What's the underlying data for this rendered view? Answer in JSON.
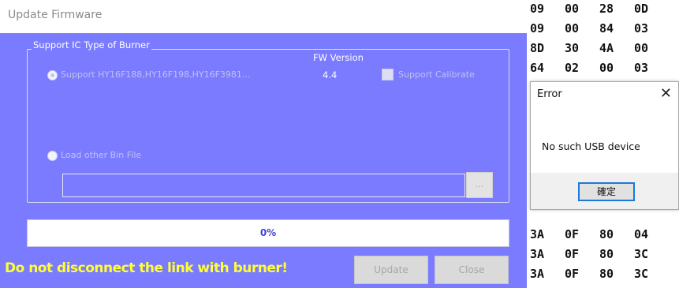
{
  "dialog": {
    "title": "Update Firmware",
    "group_title": "Support IC Type of Burner",
    "fw_version_label": "FW Version",
    "fw_version_value": "4.4",
    "option_support_label": "Support HY16F188,HY16F198,HY16F3981...",
    "option_support_selected": true,
    "calibrate_label": "Support Calibrate",
    "calibrate_checked": false,
    "option_load_label": "Load other Bin File",
    "option_load_selected": false,
    "bin_path_value": "",
    "browse_label": "...",
    "progress_percent": 0,
    "progress_text": "0%",
    "warning_text": "Do not disconnect the link with burner!",
    "update_label": "Update",
    "close_label": "Close",
    "colors": {
      "background": "#7b7bff",
      "warning": "#ffff33",
      "progress_text": "#4444dd"
    }
  },
  "hex_dump": {
    "rows_top": [
      [
        "09",
        "00",
        "28",
        "0D"
      ],
      [
        "09",
        "00",
        "84",
        "03"
      ],
      [
        "8D",
        "30",
        "4A",
        "00"
      ],
      [
        "64",
        "02",
        "00",
        "03"
      ]
    ],
    "rows_bottom": [
      [
        "3A",
        "0F",
        "80",
        "04"
      ],
      [
        "3A",
        "0F",
        "80",
        "3C"
      ],
      [
        "3A",
        "0F",
        "80",
        "3C"
      ]
    ]
  },
  "error_popup": {
    "title": "Error",
    "close_icon": "close-icon",
    "message": "No such USB device",
    "ok_label": "確定"
  }
}
